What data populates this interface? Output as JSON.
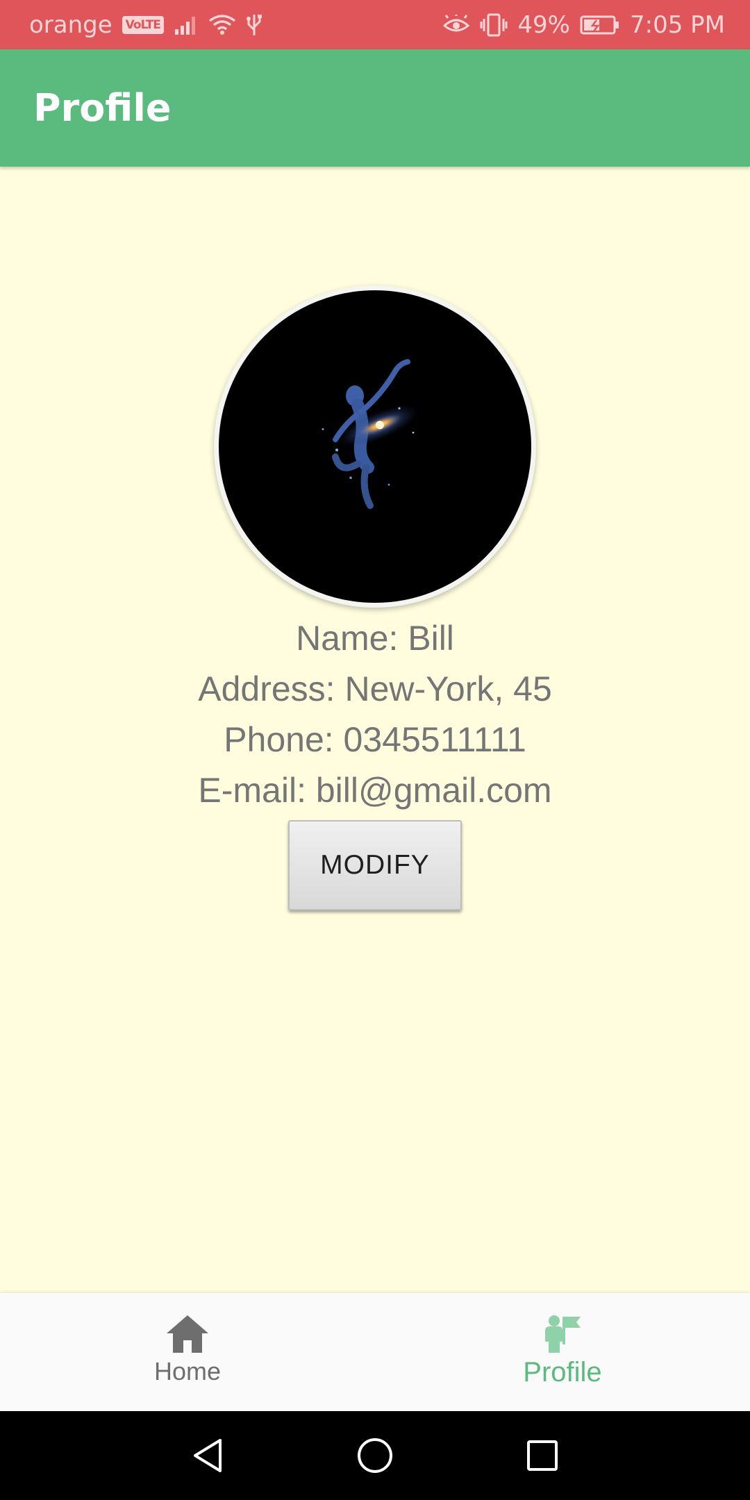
{
  "status_bar": {
    "carrier": "orange",
    "volte": "VoLTE",
    "battery": "49%",
    "time": "7:05 PM",
    "icons": [
      "signal-icon",
      "wifi-icon",
      "usb-icon",
      "eye-icon",
      "vibrate-icon",
      "battery-icon"
    ]
  },
  "app_bar": {
    "title": "Profile"
  },
  "profile": {
    "avatar_icon": "galaxy-dancer-image",
    "name_line": "Name: Bill",
    "address_line": "Address: New-York, 45",
    "phone_line": "Phone: 0345511111",
    "email_line": "E-mail: bill@gmail.com",
    "modify_label": "MODIFY"
  },
  "bottom_nav": {
    "items": [
      {
        "label": "Home",
        "icon": "home-icon",
        "active": false
      },
      {
        "label": "Profile",
        "icon": "profile-icon",
        "active": true
      }
    ]
  },
  "system_nav": {
    "icons": [
      "back-icon",
      "home-circle-icon",
      "recents-icon"
    ]
  },
  "colors": {
    "status_bar": "#E0555A",
    "app_bar": "#5BBB7F",
    "background": "#FFFDDE",
    "accent": "#5BBB7F",
    "text": "#757575"
  }
}
